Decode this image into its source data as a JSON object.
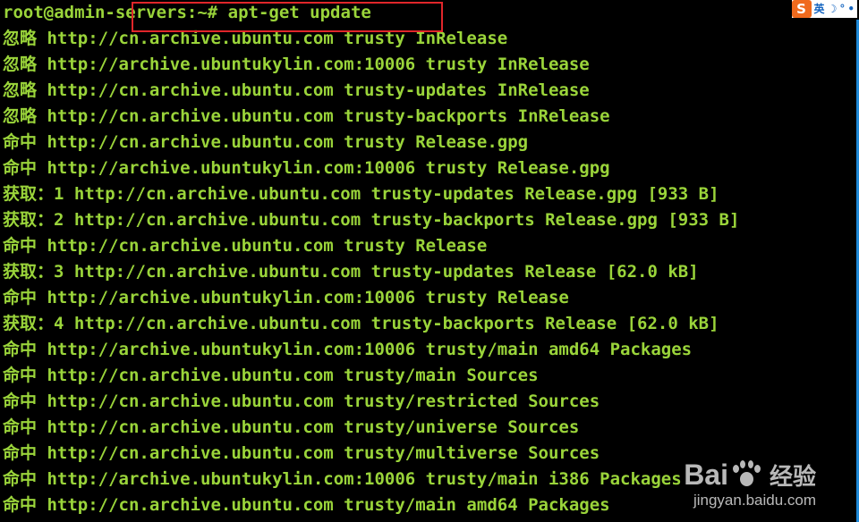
{
  "terminal": {
    "prompt": "root@admin-servers:~# ",
    "command": "apt-get update",
    "lines": [
      "忽略 http://cn.archive.ubuntu.com trusty InRelease",
      "忽略 http://archive.ubuntukylin.com:10006 trusty InRelease",
      "忽略 http://cn.archive.ubuntu.com trusty-updates InRelease",
      "忽略 http://cn.archive.ubuntu.com trusty-backports InRelease",
      "命中 http://cn.archive.ubuntu.com trusty Release.gpg",
      "命中 http://archive.ubuntukylin.com:10006 trusty Release.gpg",
      "获取：1 http://cn.archive.ubuntu.com trusty-updates Release.gpg [933 B]",
      "获取：2 http://cn.archive.ubuntu.com trusty-backports Release.gpg [933 B]",
      "命中 http://cn.archive.ubuntu.com trusty Release",
      "获取：3 http://cn.archive.ubuntu.com trusty-updates Release [62.0 kB]",
      "命中 http://archive.ubuntukylin.com:10006 trusty Release",
      "获取：4 http://cn.archive.ubuntu.com trusty-backports Release [62.0 kB]",
      "命中 http://archive.ubuntukylin.com:10006 trusty/main amd64 Packages",
      "命中 http://cn.archive.ubuntu.com trusty/main Sources",
      "命中 http://cn.archive.ubuntu.com trusty/restricted Sources",
      "命中 http://cn.archive.ubuntu.com trusty/universe Sources",
      "命中 http://cn.archive.ubuntu.com trusty/multiverse Sources",
      "命中 http://archive.ubuntukylin.com:10006 trusty/main i386 Packages",
      "命中 http://cn.archive.ubuntu.com trusty/main amd64 Packages"
    ]
  },
  "ime_toolbar": {
    "logo": "S",
    "lang": "英",
    "moon_icon": "☽",
    "dot_icon": "°",
    "dot": "•"
  },
  "watermark": {
    "brand": "Bai",
    "brand_suffix": "du",
    "cn": "经验",
    "url": "jingyan.baidu.com"
  },
  "colors": {
    "text": "#9ad43a",
    "background": "#000000",
    "highlight": "#e0262a"
  }
}
